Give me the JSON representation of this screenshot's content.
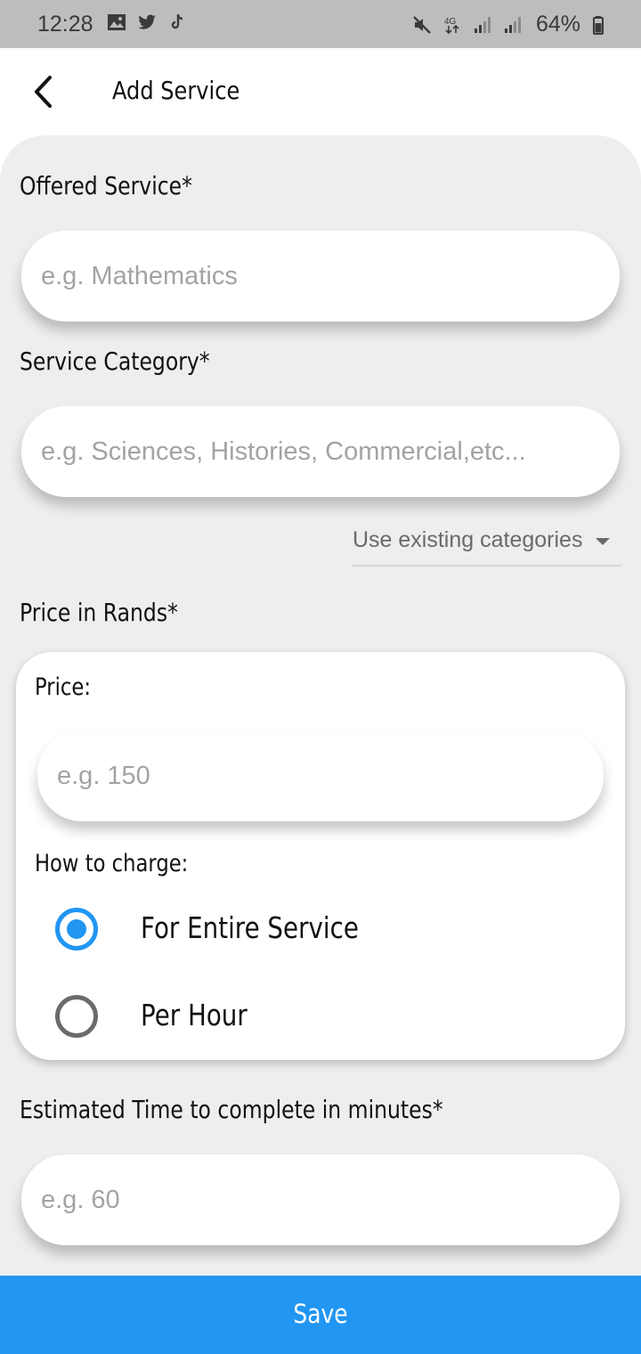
{
  "status_bar": {
    "time": "12:28",
    "left_icons": [
      "gallery-icon",
      "twitter-icon",
      "tiktok-icon"
    ],
    "right_icons": [
      "mute-icon",
      "network-4g-icon",
      "signal-icon",
      "signal-icon-2",
      "battery-icon"
    ],
    "battery_percent": "64%"
  },
  "header": {
    "back_icon": "chevron-left-icon",
    "title": "Add Service"
  },
  "form": {
    "offered_service": {
      "label": "Offered Service*",
      "value": "",
      "placeholder": "e.g. Mathematics"
    },
    "service_category": {
      "label": "Service Category*",
      "value": "",
      "placeholder": "e.g. Sciences, Histories, Commercial,etc..."
    },
    "existing_categories_dropdown": {
      "label": "Use existing categories",
      "icon": "dropdown-arrow-icon"
    },
    "price_section": {
      "label": "Price in Rands*",
      "price_label": "Price:",
      "price_value": "",
      "price_placeholder": "e.g. 150",
      "charge_label": "How to charge:",
      "options": [
        {
          "label": "For Entire Service",
          "selected": true
        },
        {
          "label": "Per Hour",
          "selected": false
        }
      ]
    },
    "estimated_time": {
      "label": "Estimated Time to complete in minutes*",
      "value": "",
      "placeholder": "e.g. 60"
    }
  },
  "actions": {
    "save_label": "Save"
  },
  "colors": {
    "accent": "#2196f3",
    "background": "#eeeeee",
    "status_bar": "#bdbdbd"
  }
}
